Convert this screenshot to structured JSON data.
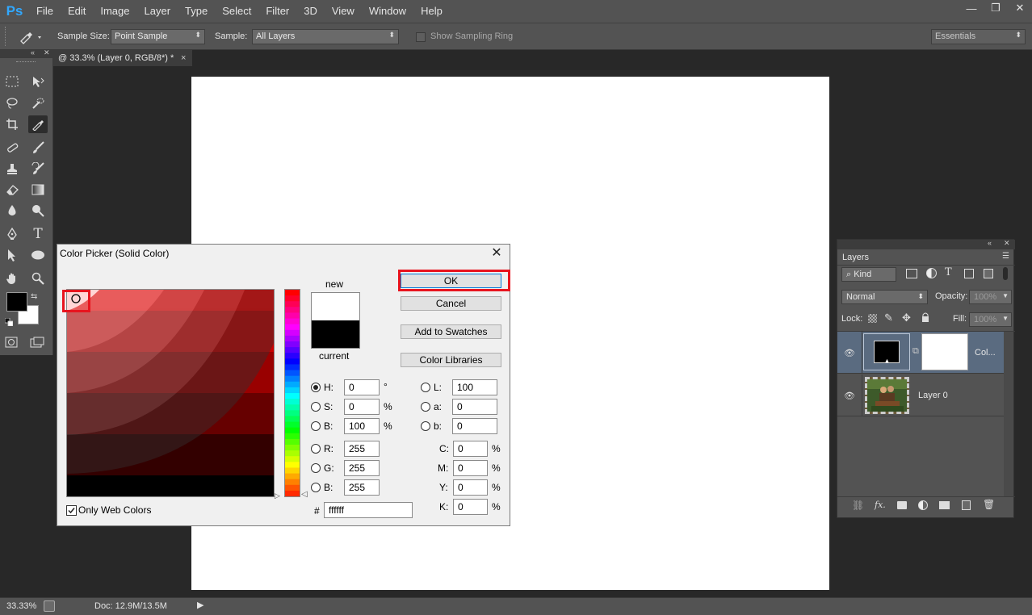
{
  "app": {
    "logo": "Ps"
  },
  "menu": [
    "File",
    "Edit",
    "Image",
    "Layer",
    "Type",
    "Select",
    "Filter",
    "3D",
    "View",
    "Window",
    "Help"
  ],
  "window_controls": {
    "minimize": "—",
    "restore": "❐",
    "close": "✕"
  },
  "options_bar": {
    "sample_size_label": "Sample Size:",
    "sample_size_value": "Point Sample",
    "sample_label": "Sample:",
    "sample_value": "All Layers",
    "sampling_ring_label": "Show Sampling Ring",
    "workspace": "Essentials"
  },
  "document": {
    "tab_title": "@ 33.3% (Layer 0, RGB/8*) *",
    "tab_close": "×"
  },
  "status_bar": {
    "zoom": "33.33%",
    "doc_info": "Doc: 12.9M/13.5M"
  },
  "layers_panel": {
    "tab": "Layers",
    "filter_kind": "Kind",
    "blend_mode": "Normal",
    "opacity_label": "Opacity:",
    "opacity_value": "100%",
    "lock_label": "Lock:",
    "fill_label": "Fill:",
    "fill_value": "100%",
    "layers": [
      {
        "name": "Col...",
        "type": "fill"
      },
      {
        "name": "Layer 0",
        "type": "photo"
      }
    ]
  },
  "color_picker": {
    "title": "Color Picker (Solid Color)",
    "close": "✕",
    "new_label": "new",
    "current_label": "current",
    "buttons": {
      "ok": "OK",
      "cancel": "Cancel",
      "add_to_swatches": "Add to Swatches",
      "color_libraries": "Color Libraries"
    },
    "hsb": [
      {
        "label": "H:",
        "value": "0",
        "unit": "°"
      },
      {
        "label": "S:",
        "value": "0",
        "unit": "%"
      },
      {
        "label": "B:",
        "value": "100",
        "unit": "%"
      }
    ],
    "rgb": [
      {
        "label": "R:",
        "value": "255"
      },
      {
        "label": "G:",
        "value": "255"
      },
      {
        "label": "B:",
        "value": "255"
      }
    ],
    "lab": [
      {
        "label": "L:",
        "value": "100"
      },
      {
        "label": "a:",
        "value": "0"
      },
      {
        "label": "b:",
        "value": "0"
      }
    ],
    "cmyk": [
      {
        "label": "C:",
        "value": "0",
        "unit": "%"
      },
      {
        "label": "M:",
        "value": "0",
        "unit": "%"
      },
      {
        "label": "Y:",
        "value": "0",
        "unit": "%"
      },
      {
        "label": "K:",
        "value": "0",
        "unit": "%"
      }
    ],
    "hex_label": "#",
    "hex_value": "ffffff",
    "only_web_colors_label": "Only Web Colors",
    "only_web_colors_checked": true,
    "new_color": "#ffffff",
    "current_color": "#000000"
  },
  "colors": {
    "foreground": "#000000",
    "background": "#ffffff",
    "highlight": "#e8141e"
  }
}
